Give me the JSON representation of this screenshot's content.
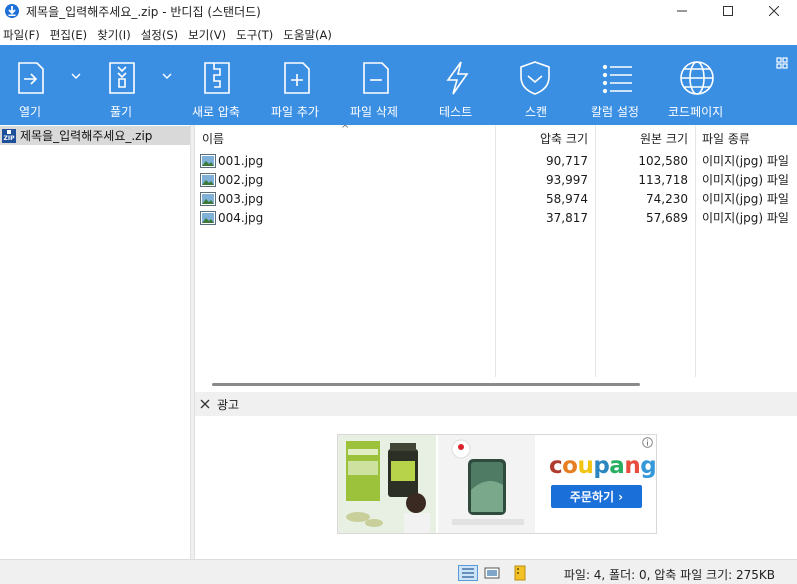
{
  "window": {
    "title": "제목을_입력해주세요_.zip - 반디집 (스탠더드)",
    "minimize": "—",
    "maximize": "☐",
    "close": "✕"
  },
  "menu": [
    "파일(F)",
    "편집(E)",
    "찾기(I)",
    "설정(S)",
    "보기(V)",
    "도구(T)",
    "도움말(A)"
  ],
  "toolbar": {
    "open": "열기",
    "extract": "풀기",
    "new_archive": "새로 압축",
    "add_files": "파일 추가",
    "delete_files": "파일 삭제",
    "test": "테스트",
    "scan": "스캔",
    "column_settings": "칼럼 설정",
    "codepage": "코드페이지"
  },
  "tree": {
    "archive_name": "제목을_입력해주세요_.zip"
  },
  "list": {
    "columns": {
      "name": "이름",
      "compressed_size": "압축 크기",
      "original_size": "원본 크기",
      "file_type": "파일 종류"
    },
    "rows": [
      {
        "name": "001.jpg",
        "compressed": "90,717",
        "original": "102,580",
        "type": "이미지(jpg) 파일"
      },
      {
        "name": "002.jpg",
        "compressed": "93,997",
        "original": "113,718",
        "type": "이미지(jpg) 파일"
      },
      {
        "name": "003.jpg",
        "compressed": "58,974",
        "original": "74,230",
        "type": "이미지(jpg) 파일"
      },
      {
        "name": "004.jpg",
        "compressed": "37,817",
        "original": "57,689",
        "type": "이미지(jpg) 파일"
      }
    ]
  },
  "ad": {
    "title": "광고",
    "brand": "coupang",
    "cta": "주문하기 ›"
  },
  "status": {
    "text": "파일: 4, 폴더: 0, 압축 파일 크기: 275KB"
  },
  "colors": {
    "toolbar_bg": "#3b8fe3",
    "cta_bg": "#1a6fd8"
  }
}
